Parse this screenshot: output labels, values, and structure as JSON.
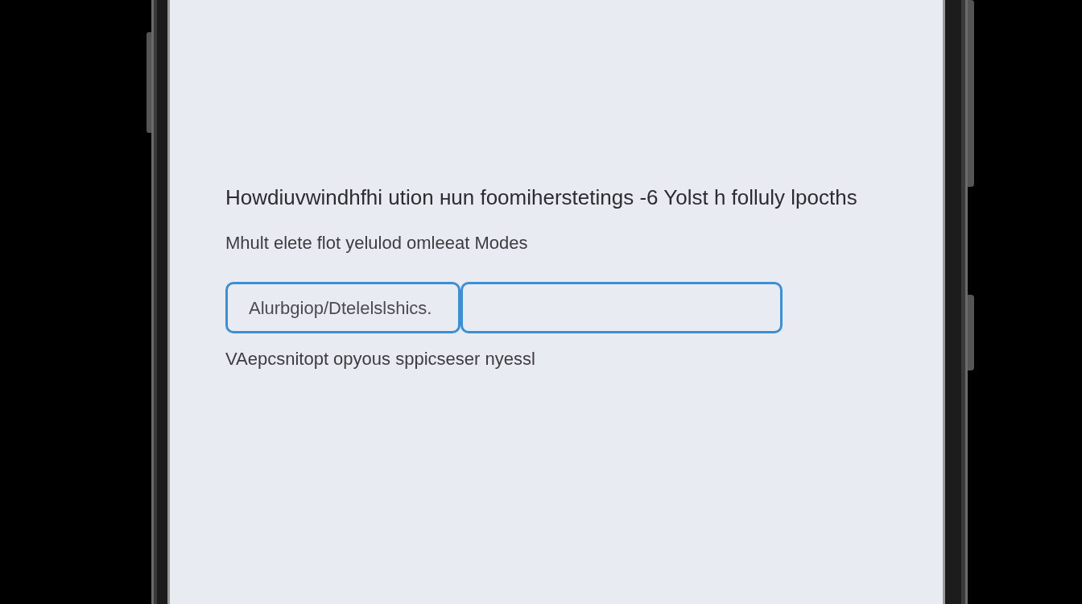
{
  "screen": {
    "title": "Howdiuvwindhfhi ution ʜun foomiherstetings -6 Yolst h folluly lpocths",
    "subtitle": "Mhult elete flot yelulod omleeat Modes",
    "field": {
      "prefix": "Alurbgiop/Dtelelslshics.",
      "focused": true
    },
    "helper": "VAepcsnitopt opyous sppicseser nyessl"
  }
}
